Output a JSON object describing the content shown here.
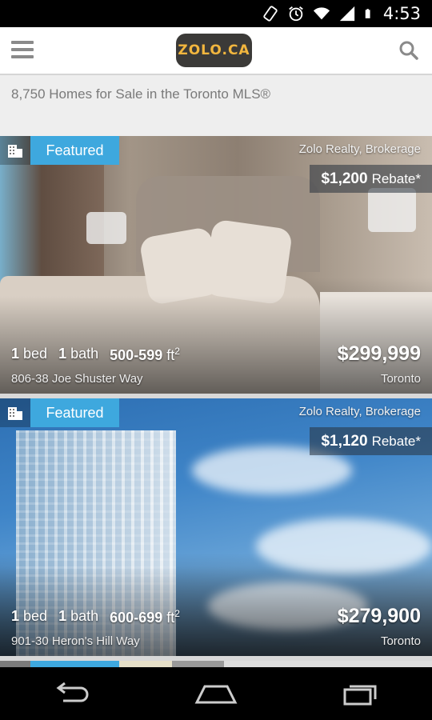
{
  "status_bar": {
    "time": "4:53",
    "icons": [
      "rotation-lock-icon",
      "alarm-icon",
      "wifi-icon",
      "signal-icon",
      "battery-icon"
    ]
  },
  "app_bar": {
    "logo_text": "ZOLO.CA",
    "menu_icon": "hamburger-menu-icon",
    "search_icon": "search-icon"
  },
  "results": {
    "count_text": "8,750 Homes for Sale in the Toronto MLS®"
  },
  "listings": [
    {
      "badge": "Featured",
      "brokerage": "Zolo Realty, Brokerage",
      "rebate_amount": "$1,200",
      "rebate_label": "Rebate*",
      "beds_num": "1",
      "beds_label": "bed",
      "baths_num": "1",
      "baths_label": "bath",
      "sqft": "500-599",
      "sqft_unit": "ft",
      "sqft_exp": "2",
      "price": "$299,999",
      "address": "806-38 Joe Shuster Way",
      "city": "Toronto"
    },
    {
      "badge": "Featured",
      "brokerage": "Zolo Realty, Brokerage",
      "rebate_amount": "$1,120",
      "rebate_label": "Rebate*",
      "beds_num": "1",
      "beds_label": "bed",
      "baths_num": "1",
      "baths_label": "bath",
      "sqft": "600-699",
      "sqft_unit": "ft",
      "sqft_exp": "2",
      "price": "$279,900",
      "address": "901-30 Heron's Hill Way",
      "city": "Toronto"
    }
  ],
  "nav_bar": {
    "buttons": [
      "back-icon",
      "home-icon",
      "recent-apps-icon"
    ]
  },
  "colors": {
    "accent": "#3ea8de",
    "logo_bg": "#3b3a38",
    "logo_text": "#f2b63e"
  }
}
